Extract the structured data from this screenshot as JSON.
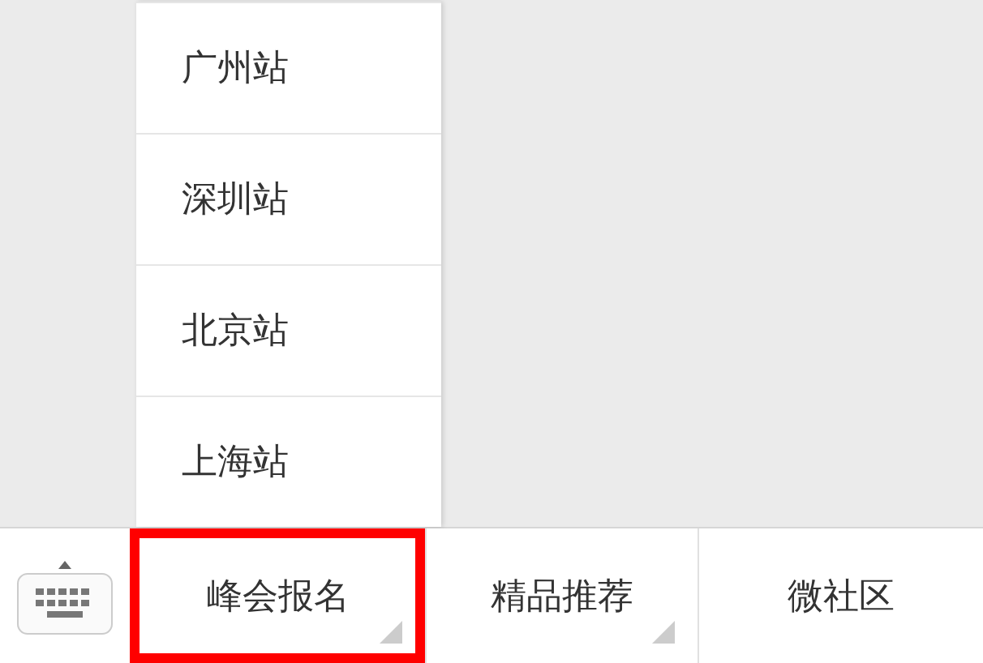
{
  "popup_menu": {
    "items": [
      {
        "label": "广州站"
      },
      {
        "label": "深圳站"
      },
      {
        "label": "北京站"
      },
      {
        "label": "上海站"
      }
    ]
  },
  "bottom_menu": {
    "items": [
      {
        "label": "峰会报名",
        "has_submenu": true,
        "highlighted": true
      },
      {
        "label": "精品推荐",
        "has_submenu": true,
        "highlighted": false
      },
      {
        "label": "微社区",
        "has_submenu": false,
        "highlighted": false
      }
    ]
  }
}
